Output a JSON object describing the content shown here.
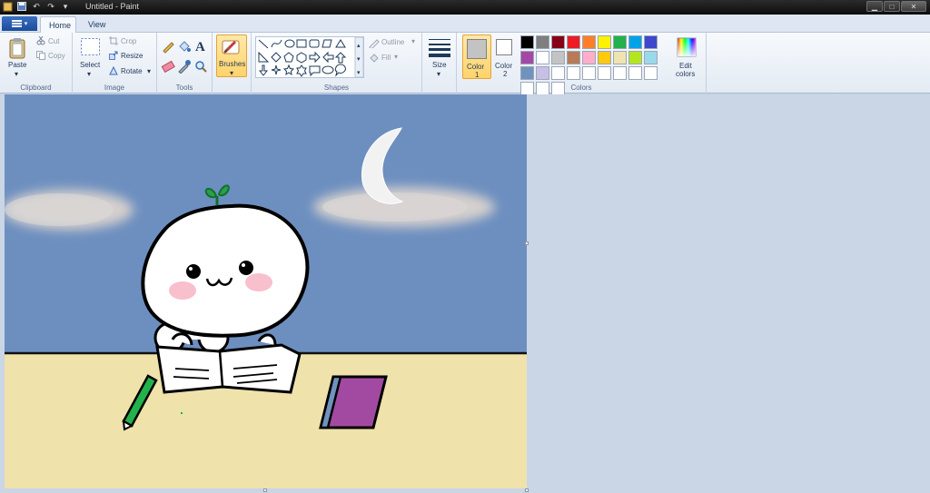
{
  "window": {
    "title": "Untitled - Paint",
    "quick_access": [
      {
        "name": "save-icon",
        "glyph": "▪"
      },
      {
        "name": "undo-icon",
        "glyph": "↶"
      },
      {
        "name": "redo-icon",
        "glyph": "↷"
      },
      {
        "name": "customize-icon",
        "glyph": "▾"
      }
    ],
    "controls": {
      "minimize": "▁",
      "maximize": "□",
      "close": "✕"
    }
  },
  "tabs": {
    "home": "Home",
    "view": "View"
  },
  "ribbon": {
    "clipboard": {
      "label": "Clipboard",
      "paste": "Paste",
      "cut": "Cut",
      "copy": "Copy"
    },
    "image": {
      "label": "Image",
      "select": "Select",
      "crop": "Crop",
      "resize": "Resize",
      "rotate": "Rotate"
    },
    "tools": {
      "label": "Tools"
    },
    "brushes": {
      "label": "Brushes"
    },
    "shapes": {
      "label": "Shapes",
      "outline": "Outline",
      "fill": "Fill"
    },
    "size": {
      "label": "Size"
    },
    "colors": {
      "label": "Colors",
      "color1_label": "Color",
      "color1_num": "1",
      "color2_label": "Color",
      "color2_num": "2",
      "edit_label": "Edit",
      "edit_label2": "colors",
      "color1_value": "#c3c3c3",
      "color2_value": "#ffffff",
      "palette": [
        "#000000",
        "#7f7f7f",
        "#880015",
        "#ed1c24",
        "#ff7f27",
        "#fff200",
        "#22b14c",
        "#00a2e8",
        "#3f48cc",
        "#a349a4",
        "#ffffff",
        "#c3c3c3",
        "#b97a57",
        "#ffaec9",
        "#ffc90e",
        "#efe4b0",
        "#b5e61d",
        "#99d9ea",
        "#7092be",
        "#c8bfe7",
        "#ffffff",
        "#ffffff",
        "#ffffff",
        "#ffffff",
        "#ffffff",
        "#ffffff",
        "#ffffff",
        "#ffffff",
        "#ffffff",
        "#ffffff"
      ]
    }
  },
  "canvas": {
    "sky_color": "#6d8fbf",
    "table_color": "#efe2ab",
    "book_color": "#a24aa2"
  }
}
